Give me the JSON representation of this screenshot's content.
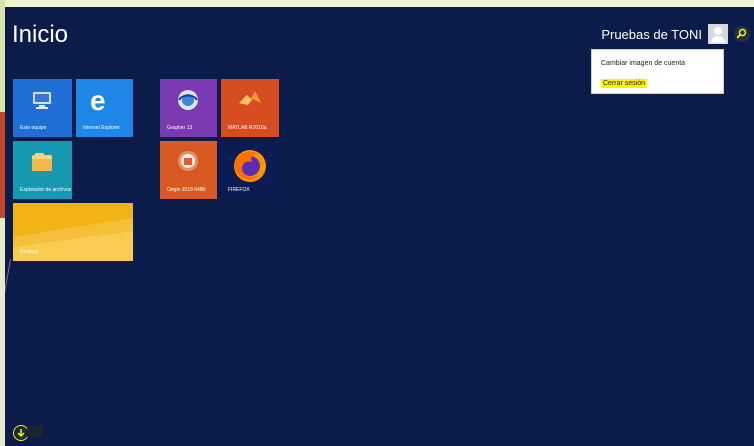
{
  "start_title": "Inicio",
  "user": {
    "name": "Pruebas de TONI"
  },
  "menu": {
    "items": [
      {
        "label": "Cambiar imagen de cuenta"
      },
      {
        "label": "Cerrar sesión"
      }
    ]
  },
  "tiles": [
    {
      "label": "Este equipo",
      "icon": "computer-icon"
    },
    {
      "label": "Internet Explorer",
      "icon": "internet-explorer-icon"
    },
    {
      "label": "Grapher 13",
      "icon": "grapher-icon"
    },
    {
      "label": "MATLAB R2016a",
      "icon": "matlab-icon"
    },
    {
      "label": "Explorador de archivos",
      "icon": "folder-icon"
    },
    {
      "label": "Origin 2018 64Bit",
      "icon": "origin-icon"
    },
    {
      "label": "FIREFOX",
      "icon": "firefox-icon"
    },
    {
      "label": "Desktop",
      "icon": "desktop-icon"
    }
  ],
  "colors": {
    "background": "#0b1b4a",
    "highlight": "#fff200"
  }
}
